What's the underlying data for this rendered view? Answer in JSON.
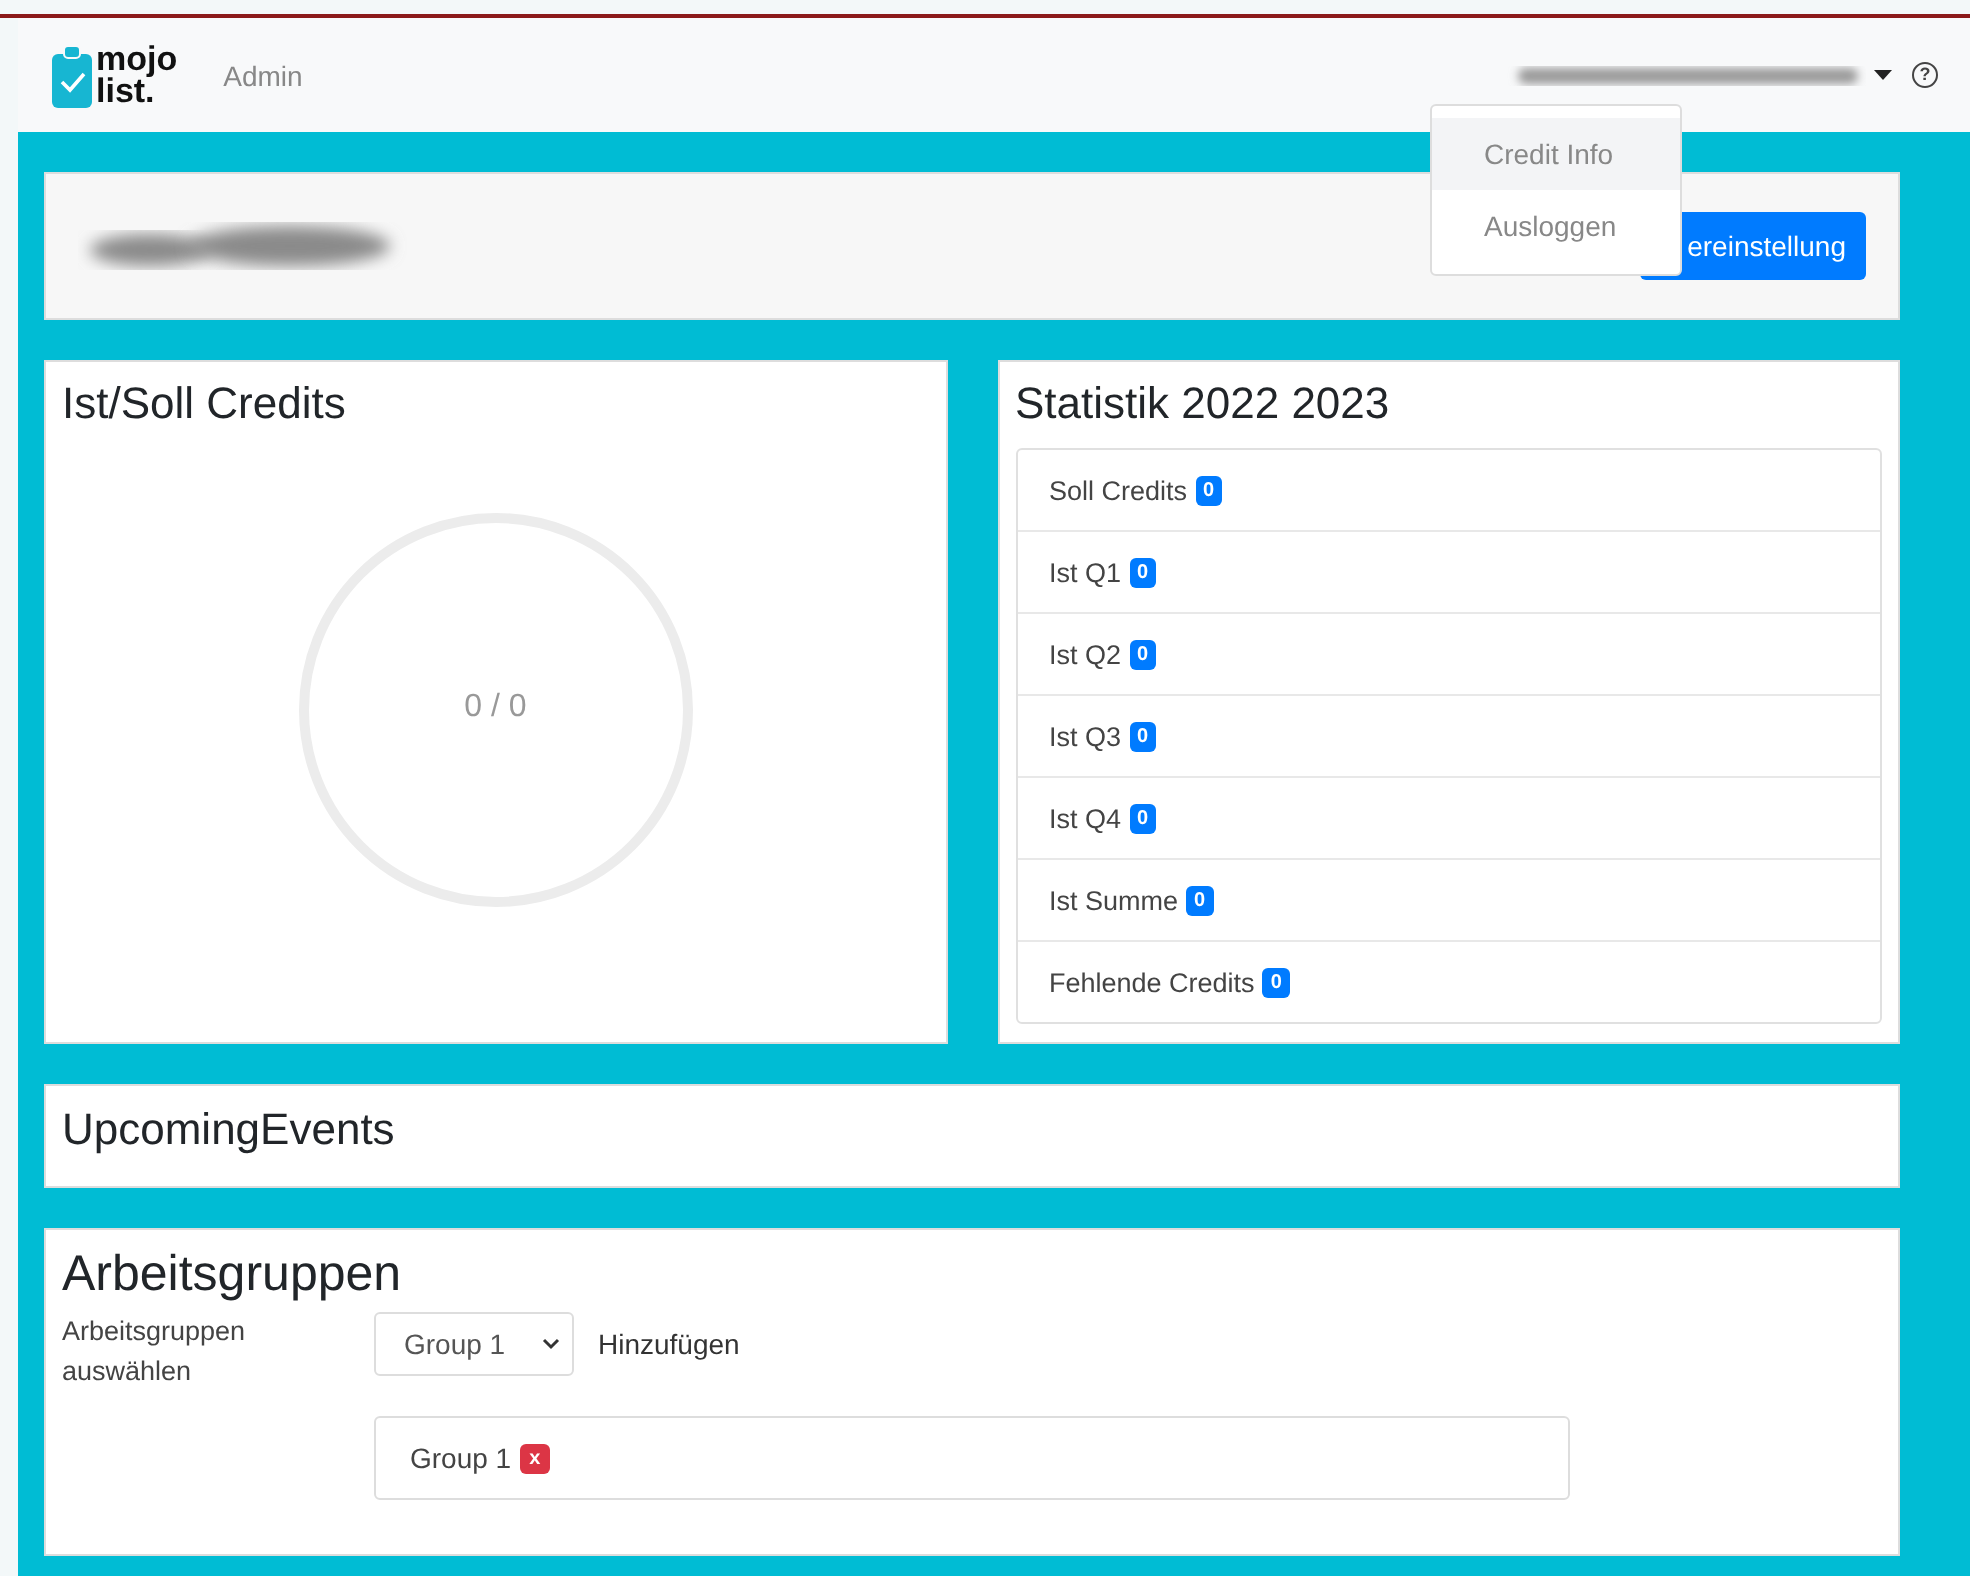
{
  "navbar": {
    "logo_top": "mojo",
    "logo_bottom": "list.",
    "link": "Admin",
    "user_menu_expanded": true,
    "help_icon": "?"
  },
  "user_menu": [
    {
      "label": "Credit Info",
      "selected": true
    },
    {
      "label": "Ausloggen",
      "selected": false
    }
  ],
  "header_card": {
    "button": "ereinstellung"
  },
  "credits_card": {
    "title": "Ist/Soll Credits",
    "level": 0,
    "reading": "0 / 0"
  },
  "stats_card": {
    "title": "Statistik 2022 2023",
    "items": [
      {
        "label": "Soll Credits",
        "count": "0"
      },
      {
        "label": "Ist Q1",
        "count": "0"
      },
      {
        "label": "Ist Q2",
        "count": "0"
      },
      {
        "label": "Ist Q3",
        "count": "0"
      },
      {
        "label": "Ist Q4",
        "count": "0"
      },
      {
        "label": "Ist Summe",
        "count": "0"
      },
      {
        "label": "Fehlende Credits",
        "count": "0"
      }
    ]
  },
  "events_card": {
    "title": "UpcomingEvents"
  },
  "groups_card": {
    "title": "Arbeitsgruppen",
    "label": "Arbeitsgruppen auswählen",
    "select_value": "Group 1",
    "add_link": "Hinzufügen",
    "groups": [
      {
        "name": "Group 1",
        "remove": "x"
      }
    ]
  }
}
